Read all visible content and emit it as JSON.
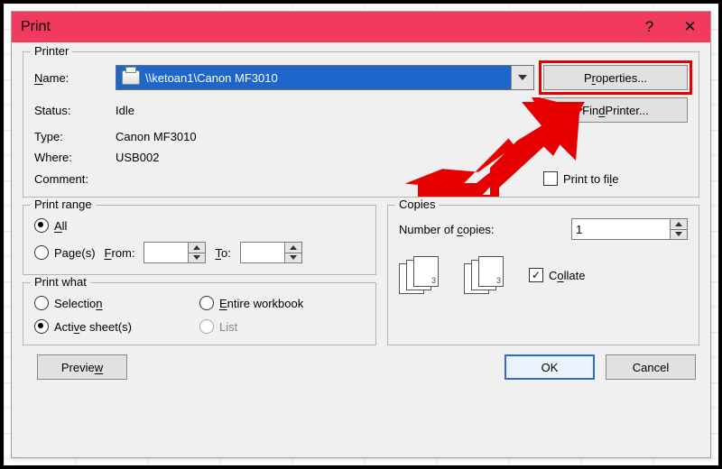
{
  "title": "Print",
  "printer": {
    "legend": "Printer",
    "name_label_pre": "",
    "name_label_und": "N",
    "name_label_post": "ame:",
    "selected": "\\\\ketoan1\\Canon MF3010",
    "status_label": "Status:",
    "status_value": "Idle",
    "type_label": "Type:",
    "type_value": "Canon MF3010",
    "where_label": "Where:",
    "where_value": "USB002",
    "comment_label": "Comment:",
    "comment_value": "",
    "properties_pre": "P",
    "properties_und": "r",
    "properties_post": "operties...",
    "find_pre": "Fin",
    "find_und": "d",
    "find_post": " Printer...",
    "print_to_file_pre": "Print to fi",
    "print_to_file_und": "l",
    "print_to_file_post": "e"
  },
  "range": {
    "legend": "Print range",
    "all_und": "A",
    "all_post": "ll",
    "pages_pre": "Pa",
    "pages_und": "g",
    "pages_post": "e(s)",
    "from_und": "F",
    "from_post": "rom:",
    "to_und": "T",
    "to_post": "o:",
    "from_value": "",
    "to_value": ""
  },
  "what": {
    "legend": "Print what",
    "sel_pre": "Selectio",
    "sel_und": "n",
    "entire_und": "E",
    "entire_post": "ntire workbook",
    "active_pre": "Acti",
    "active_und": "v",
    "active_post": "e sheet(s)",
    "list_label": "List"
  },
  "copies": {
    "legend": "Copies",
    "num_pre": "Number of ",
    "num_und": "c",
    "num_post": "opies:",
    "num_value": "1",
    "collate_pre": "C",
    "collate_und": "o",
    "collate_post": "llate"
  },
  "footer": {
    "preview_pre": "Previe",
    "preview_und": "w",
    "ok": "OK",
    "cancel": "Cancel"
  }
}
